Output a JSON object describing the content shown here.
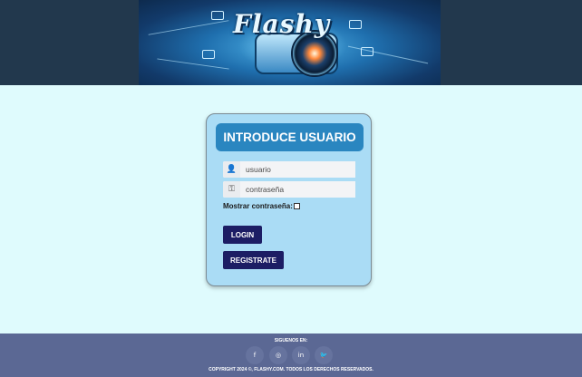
{
  "header": {
    "logo_text": "Flashy"
  },
  "login": {
    "title": "INTRODUCE USUARIO",
    "username_placeholder": "usuario",
    "password_placeholder": "contraseña",
    "username_icon": "user-icon",
    "password_icon": "key-icon",
    "show_password_label": "Mostrar contraseña:",
    "login_button": "LOGIN",
    "register_button": "REGISTRATE"
  },
  "footer": {
    "follow_text": "SIGUENOS EN:",
    "social": [
      {
        "icon": "facebook-icon",
        "glyph": "f"
      },
      {
        "icon": "instagram-icon",
        "glyph": "◎"
      },
      {
        "icon": "linkedin-icon",
        "glyph": "in"
      },
      {
        "icon": "twitter-icon",
        "glyph": "🐦"
      }
    ],
    "copyright": "COPYRIGHT 2024 ©, FLASHY.COM. TODOS LOS DERECHOS RESERVADOS."
  },
  "colors": {
    "header_bg": "#22384d",
    "page_bg": "#dffbfd",
    "card_bg": "#aadcf5",
    "title_bg": "#2a86c0",
    "button_bg": "#1c1d64",
    "footer_bg": "#5b6894"
  }
}
